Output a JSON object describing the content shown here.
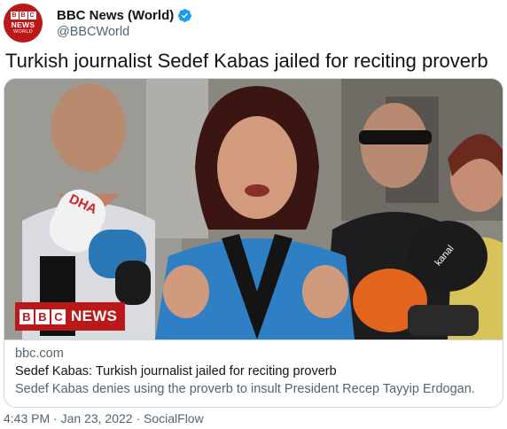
{
  "account": {
    "display_name": "BBC News (World)",
    "handle": "@BBCWorld",
    "avatar": {
      "row_letters": [
        "B",
        "B",
        "C"
      ],
      "line1": "NEWS",
      "line2": "WORLD"
    },
    "verified_icon": "verified-badge-icon"
  },
  "tweet": {
    "text": "Turkish journalist Sedef Kabas jailed for reciting proverb"
  },
  "card": {
    "badge": {
      "letters": [
        "B",
        "B",
        "C"
      ],
      "word": "NEWS"
    },
    "domain": "bbc.com",
    "title": "Sedef Kabas: Turkish journalist jailed for reciting proverb",
    "description": "Sedef Kabas denies using the proverb to insult President Recep Tayyip Erdogan."
  },
  "footer": {
    "time": "4:43 PM",
    "date": "Jan 23, 2022",
    "source": "SocialFlow",
    "separator": "·"
  },
  "colors": {
    "bbc_red": "#bb1919",
    "verified_blue": "#1d9bf0",
    "secondary_text": "#536471",
    "border": "#cfd9de"
  }
}
